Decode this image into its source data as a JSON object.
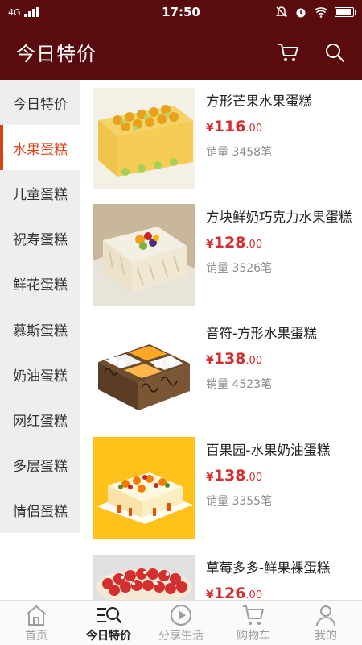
{
  "status": {
    "network": "4G",
    "time": "17:50"
  },
  "header": {
    "title": "今日特价",
    "cart_icon": "cart-icon",
    "search_icon": "search-icon",
    "bg_color": "#5a0b0e"
  },
  "sidebar": {
    "accent_color": "#d84315",
    "items": [
      {
        "label": "今日特价"
      },
      {
        "label": "水果蛋糕",
        "active": true
      },
      {
        "label": "儿童蛋糕"
      },
      {
        "label": "祝寿蛋糕"
      },
      {
        "label": "鲜花蛋糕"
      },
      {
        "label": "慕斯蛋糕"
      },
      {
        "label": "奶油蛋糕"
      },
      {
        "label": "网红蛋糕"
      },
      {
        "label": "多层蛋糕"
      },
      {
        "label": "情侣蛋糕"
      }
    ]
  },
  "products": [
    {
      "name": "方形芒果水果蛋糕",
      "currency": "¥",
      "price_int": "116",
      "price_dec": ".00",
      "sales": "销量 3458笔"
    },
    {
      "name": "方块鲜奶巧克力水果蛋糕",
      "currency": "¥",
      "price_int": "128",
      "price_dec": ".00",
      "sales": "销量 3526笔"
    },
    {
      "name": "音符-方形水果蛋糕",
      "currency": "¥",
      "price_int": "138",
      "price_dec": ".00",
      "sales": "销量 4523笔"
    },
    {
      "name": "百果园-水果奶油蛋糕",
      "currency": "¥",
      "price_int": "138",
      "price_dec": ".00",
      "sales": "销量 3355笔"
    },
    {
      "name": "草莓多多-鲜果裸蛋糕",
      "currency": "¥",
      "price_int": "126",
      "price_dec": ".00",
      "sales": ""
    }
  ],
  "bottom_nav": {
    "items": [
      {
        "label": "首页",
        "icon": "home-icon"
      },
      {
        "label": "今日特价",
        "icon": "deals-search-icon",
        "active": true
      },
      {
        "label": "分享生活",
        "icon": "play-circle-icon"
      },
      {
        "label": "购物车",
        "icon": "cart-icon"
      },
      {
        "label": "我的",
        "icon": "user-icon"
      }
    ]
  }
}
